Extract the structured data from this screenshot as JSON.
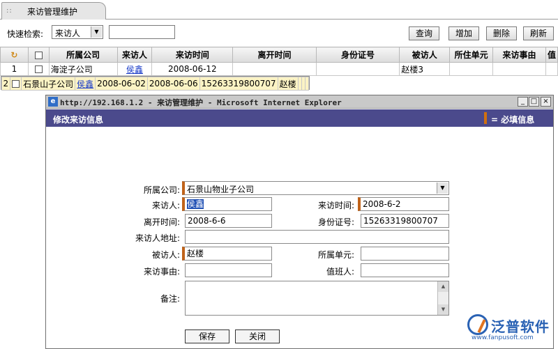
{
  "tab": {
    "title": "来访管理维护"
  },
  "toolbar": {
    "search_label": "快速检索:",
    "search_field": "来访人",
    "search_value": "",
    "buttons": {
      "query": "查询",
      "add": "增加",
      "delete": "删除",
      "refresh": "刷新"
    }
  },
  "table": {
    "columns": [
      "所属公司",
      "来访人",
      "来访时间",
      "离开时间",
      "身份证号",
      "被访人",
      "所住单元",
      "来访事由",
      "值"
    ],
    "rows": [
      {
        "no": "1",
        "company": "海淀子公司",
        "visitor": "侯鑫",
        "visit_time": "2008-06-12",
        "leave_time": "",
        "id_no": "",
        "visitee": "赵楼3",
        "unit": "",
        "reason": "",
        "duty": ""
      },
      {
        "no": "2",
        "company": "石景山子公司",
        "visitor": "侯鑫",
        "visit_time": "2008-06-02",
        "leave_time": "2008-06-06",
        "id_no": "15263319800707",
        "visitee": "赵楼",
        "unit": "",
        "reason": "",
        "duty": ""
      }
    ]
  },
  "dialog": {
    "title": "http://192.168.1.2 - 来访管理维护 - Microsoft Internet Explorer",
    "header": "修改来访信息",
    "required_legend": "= 必填信息",
    "labels": {
      "company": "所属公司:",
      "visitor": "来访人:",
      "visit_time": "来访时间:",
      "leave_time": "离开时间:",
      "id_no": "身份证号:",
      "address": "来访人地址:",
      "visitee": "被访人:",
      "unit": "所属单元:",
      "reason": "来访事由:",
      "duty": "值班人:",
      "remark": "备注:"
    },
    "values": {
      "company": "石景山物业子公司",
      "visitor": "侯鑫",
      "visit_time": "2008-6-2",
      "leave_time": "2008-6-6",
      "id_no": "15263319800707",
      "address": "",
      "visitee": "赵楼",
      "unit": "",
      "reason": "",
      "duty": "",
      "remark": ""
    },
    "buttons": {
      "save": "保存",
      "close": "关闭"
    }
  },
  "watermark": {
    "brand": "泛普软件",
    "url": "www.fanpusoft.com"
  }
}
